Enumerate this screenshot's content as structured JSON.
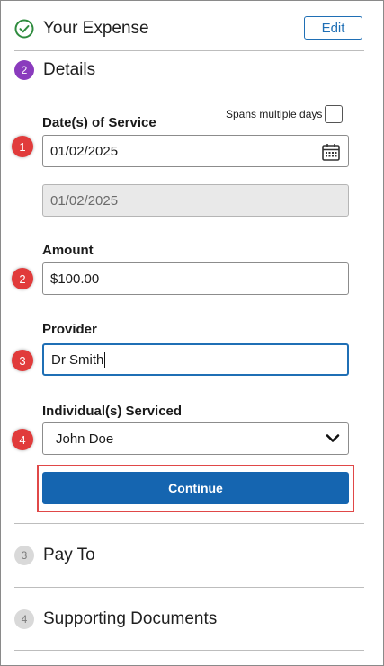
{
  "sections": {
    "your_expense": {
      "title": "Your Expense",
      "edit_label": "Edit"
    },
    "details": {
      "step": "2",
      "title": "Details"
    },
    "pay_to": {
      "step": "3",
      "title": "Pay To"
    },
    "supporting_documents": {
      "step": "4",
      "title": "Supporting Documents"
    }
  },
  "form": {
    "dates_of_service": {
      "label": "Date(s) of Service",
      "spans_multiple_days_label": "Spans multiple days",
      "spans_multiple_days_checked": false,
      "start_value": "01/02/2025",
      "end_value": "01/02/2025"
    },
    "amount": {
      "label": "Amount",
      "value": "$100.00"
    },
    "provider": {
      "label": "Provider",
      "value": "Dr Smith"
    },
    "individuals_serviced": {
      "label": "Individual(s) Serviced",
      "value": "John Doe"
    },
    "continue_label": "Continue"
  },
  "annotations": {
    "markers": [
      "1",
      "2",
      "3",
      "4"
    ],
    "marker_color": "#e13b3b"
  },
  "colors": {
    "accent": "#1565b0",
    "active_step": "#8a3bbd",
    "complete_check": "#2e8b3e"
  }
}
